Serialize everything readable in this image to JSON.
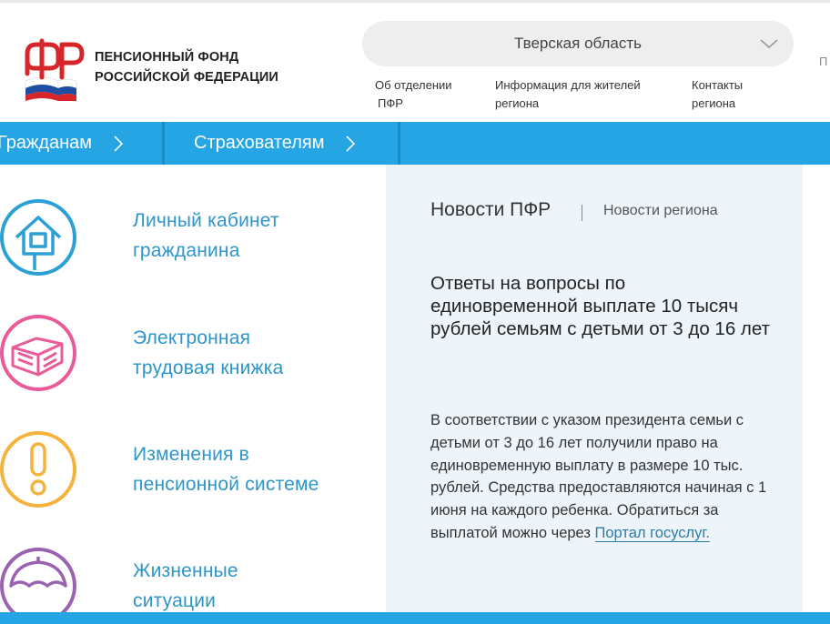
{
  "header": {
    "logo_line1": "ПЕНСИОННЫЙ ФОНД",
    "logo_line2": "РОССИЙСКОЙ ФЕДЕРАЦИИ",
    "region": "Тверская область",
    "links": [
      {
        "line1": "Об отделении",
        "line2": "ПФР"
      },
      {
        "line1": "Информация для жителей",
        "line2": "региона"
      },
      {
        "line1": "Контакты",
        "line2": "региона"
      }
    ],
    "edge_text": "П"
  },
  "nav": {
    "tabs": [
      {
        "label": "Гражданам"
      },
      {
        "label": "Страхователям"
      }
    ]
  },
  "menu": {
    "items": [
      {
        "line1": "Личный кабинет",
        "line2": "гражданина",
        "icon": "house-icon",
        "color": "#2aa0d6"
      },
      {
        "line1": "Электронная",
        "line2": "трудовая книжка",
        "icon": "book-icon",
        "color": "#ea5a98"
      },
      {
        "line1": "Изменения в",
        "line2": "пенсионной системе",
        "icon": "exclamation-icon",
        "color": "#f3b33d"
      },
      {
        "line1": "Жизненные",
        "line2": "ситуации",
        "icon": "umbrella-icon",
        "color": "#9a62b0"
      }
    ]
  },
  "news": {
    "tab_active": "Новости ПФР",
    "tab_other": "Новости региона",
    "title": "Ответы на вопросы по единовременной выплате 10 тысяч рублей семьям с детьми от 3 до 16 лет",
    "body": "В соответствии с указом президента семьи с детьми от 3 до 16 лет получили право на единовременную выплату в размере 10 тыс. рублей. Средства предоставляются начиная с 1 июня на каждого ребенка. Обратиться за выплатой можно через ",
    "link": "Портал госуслуг."
  },
  "colors": {
    "brand_blue": "#26a5e4",
    "link_blue": "#2d95c8",
    "logo_red": "#d7262a"
  }
}
